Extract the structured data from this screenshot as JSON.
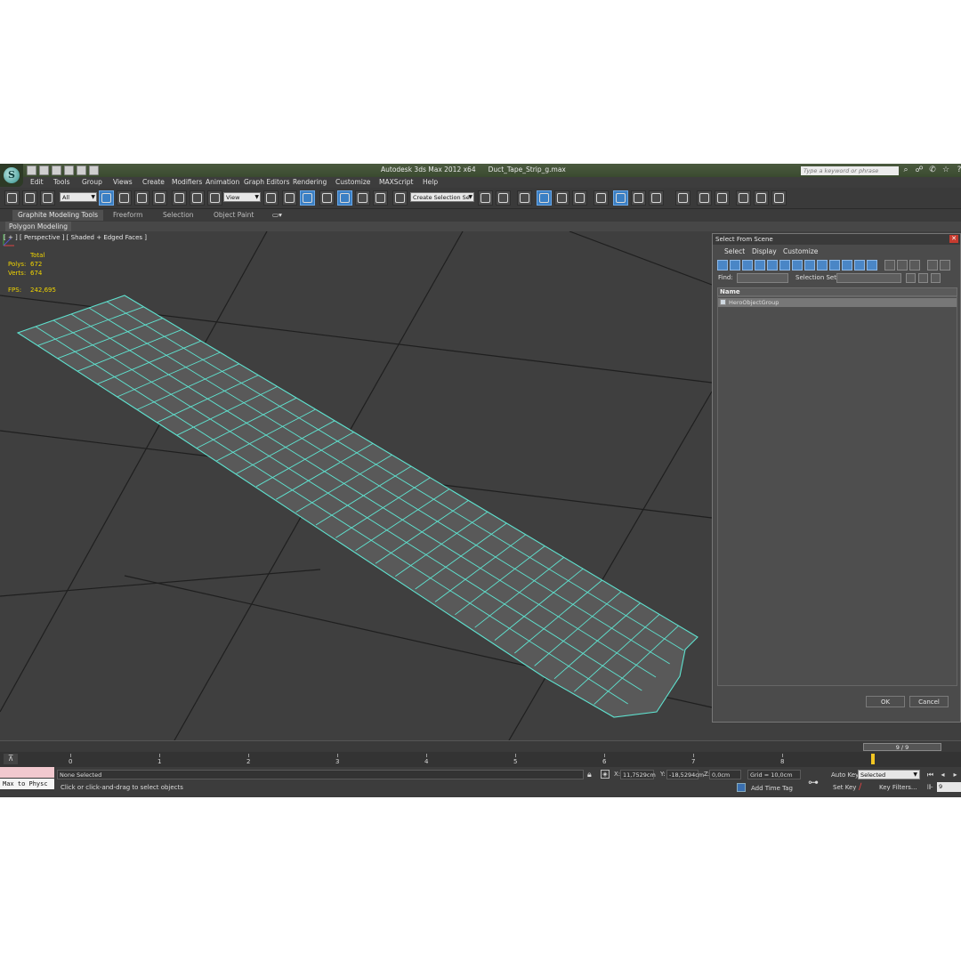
{
  "title": {
    "app": "Autodesk 3ds Max  2012 x64",
    "file": "Duct_Tape_Strip_g.max",
    "search_placeholder": "Type a keyword or phrase",
    "logo_letter": "S"
  },
  "menu": [
    "Edit",
    "Tools",
    "Group",
    "Views",
    "Create",
    "Modifiers",
    "Animation",
    "Graph Editors",
    "Rendering",
    "Customize",
    "MAXScript",
    "Help"
  ],
  "toolbar": {
    "selection_filter": "All",
    "reference_coord": "View",
    "named_selection": "Create Selection Se"
  },
  "ribbon": {
    "tabs": [
      "Graphite Modeling Tools",
      "Freeform",
      "Selection",
      "Object Paint"
    ],
    "active_tab": "Graphite Modeling Tools",
    "sub_panel": "Polygon Modeling"
  },
  "viewport": {
    "label": "[ + ] [ Perspective ] [ Shaded + Edged Faces ]",
    "stats": {
      "header": "Total",
      "polys_label": "Polys:",
      "polys": "672",
      "verts_label": "Verts:",
      "verts": "674",
      "fps_label": "FPS:",
      "fps": "242,695"
    },
    "grid_color": "#1a1a1a",
    "wire_color": "#5fe3d0",
    "surface_color": "#575757"
  },
  "dialog": {
    "title": "Select From Scene",
    "menu": [
      "Select",
      "Display",
      "Customize"
    ],
    "find_label": "Find:",
    "selection_set_label": "Selection Set:",
    "column_name": "Name",
    "items": [
      "HeroObjectGroup"
    ],
    "ok": "OK",
    "cancel": "Cancel"
  },
  "timeline": {
    "frame_display": "9 / 9",
    "ticks": [
      "0",
      "1",
      "2",
      "3",
      "4",
      "5",
      "6",
      "7",
      "8"
    ]
  },
  "status": {
    "mini_listener": "Max to Physc",
    "selection": "None Selected",
    "prompt": "Click or click-and-drag to select objects",
    "x_label": "X:",
    "x": "11,7529cm",
    "y_label": "Y:",
    "y": "-18,5294cm",
    "z_label": "Z:",
    "z": "0,0cm",
    "grid": "Grid = 10,0cm",
    "add_time_tag": "Add Time Tag",
    "auto_key": "Auto Key",
    "auto_key_mode": "Selected",
    "set_key": "Set Key",
    "key_filters": "Key Filters...",
    "current_frame": "9"
  }
}
